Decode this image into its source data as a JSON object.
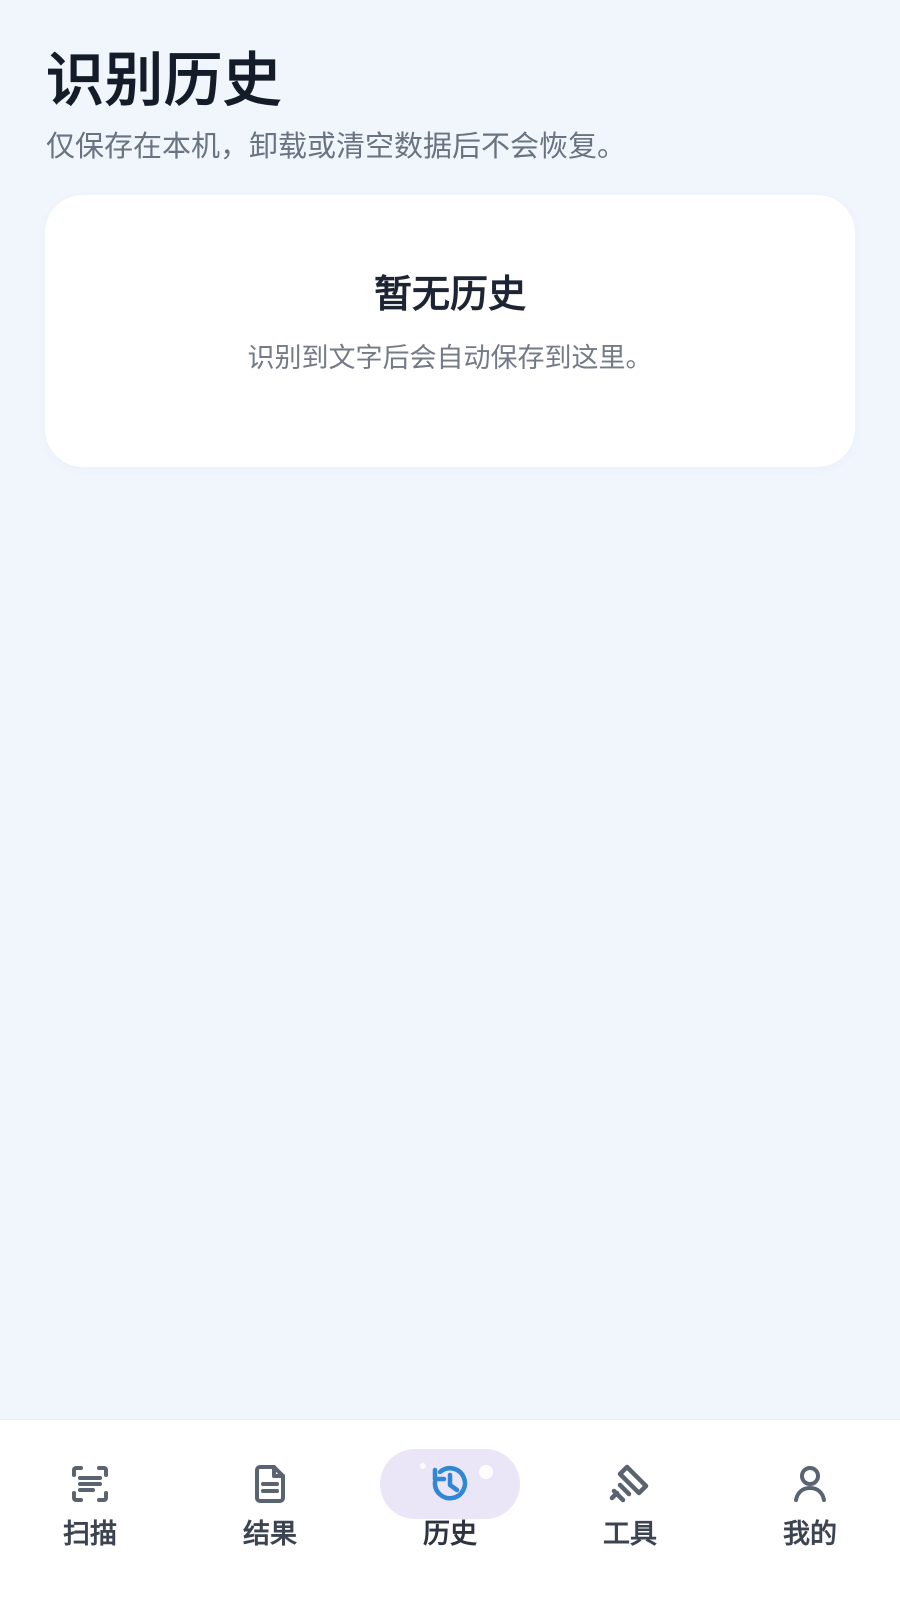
{
  "page": {
    "title": "识别历史",
    "subtitle": "仅保存在本机，卸载或清空数据后不会恢复。"
  },
  "empty_state": {
    "title": "暂无历史",
    "description": "识别到文字后会自动保存到这里。"
  },
  "bottom_nav": {
    "items": [
      {
        "label": "扫描",
        "icon": "scan-icon"
      },
      {
        "label": "结果",
        "icon": "document-icon"
      },
      {
        "label": "历史",
        "icon": "history-icon",
        "active": true
      },
      {
        "label": "工具",
        "icon": "tools-icon"
      },
      {
        "label": "我的",
        "icon": "profile-icon"
      }
    ],
    "colors": {
      "active_icon": "#2f87d6",
      "active_bg": "#ebe5f8",
      "inactive_icon": "#5a6370"
    }
  }
}
